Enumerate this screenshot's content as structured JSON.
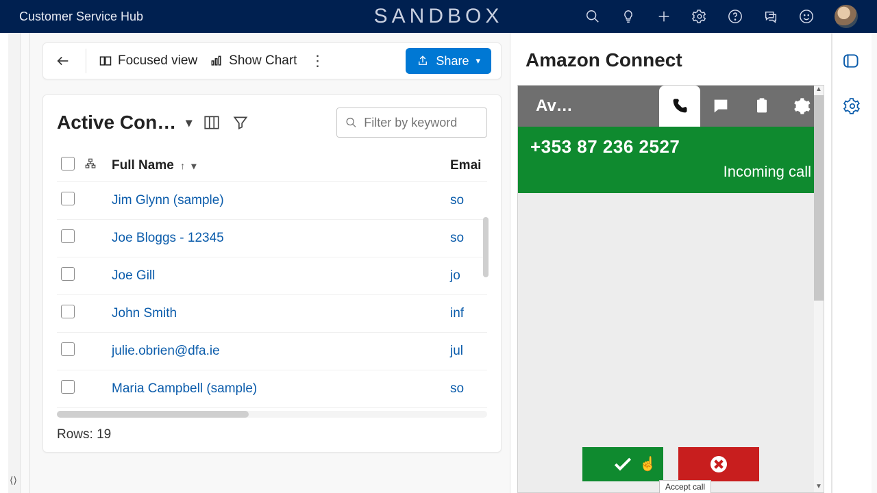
{
  "topnav": {
    "title": "Customer Service Hub",
    "env_badge": "SANDBOX"
  },
  "commandbar": {
    "focused_view": "Focused view",
    "show_chart": "Show Chart",
    "share": "Share"
  },
  "grid": {
    "view_name": "Active Con…",
    "filter_placeholder": "Filter by keyword",
    "columns": {
      "fullname": "Full Name",
      "email": "Emai"
    },
    "rows_label": "Rows:",
    "rows_count": "19",
    "rows": [
      {
        "name": "Jim Glynn (sample)",
        "email": "so"
      },
      {
        "name": "Joe Bloggs - 12345",
        "email": "so"
      },
      {
        "name": "Joe Gill",
        "email": "jo"
      },
      {
        "name": "John Smith",
        "email": "inf"
      },
      {
        "name": "julie.obrien@dfa.ie",
        "email": "jul"
      },
      {
        "name": "Maria Campbell (sample)",
        "email": "so"
      }
    ]
  },
  "connect": {
    "panel_title": "Amazon Connect",
    "agent_status": "Av…",
    "caller_number": "+353 87 236 2527",
    "call_state": "Incoming call",
    "tooltip_accept": "Accept call"
  }
}
